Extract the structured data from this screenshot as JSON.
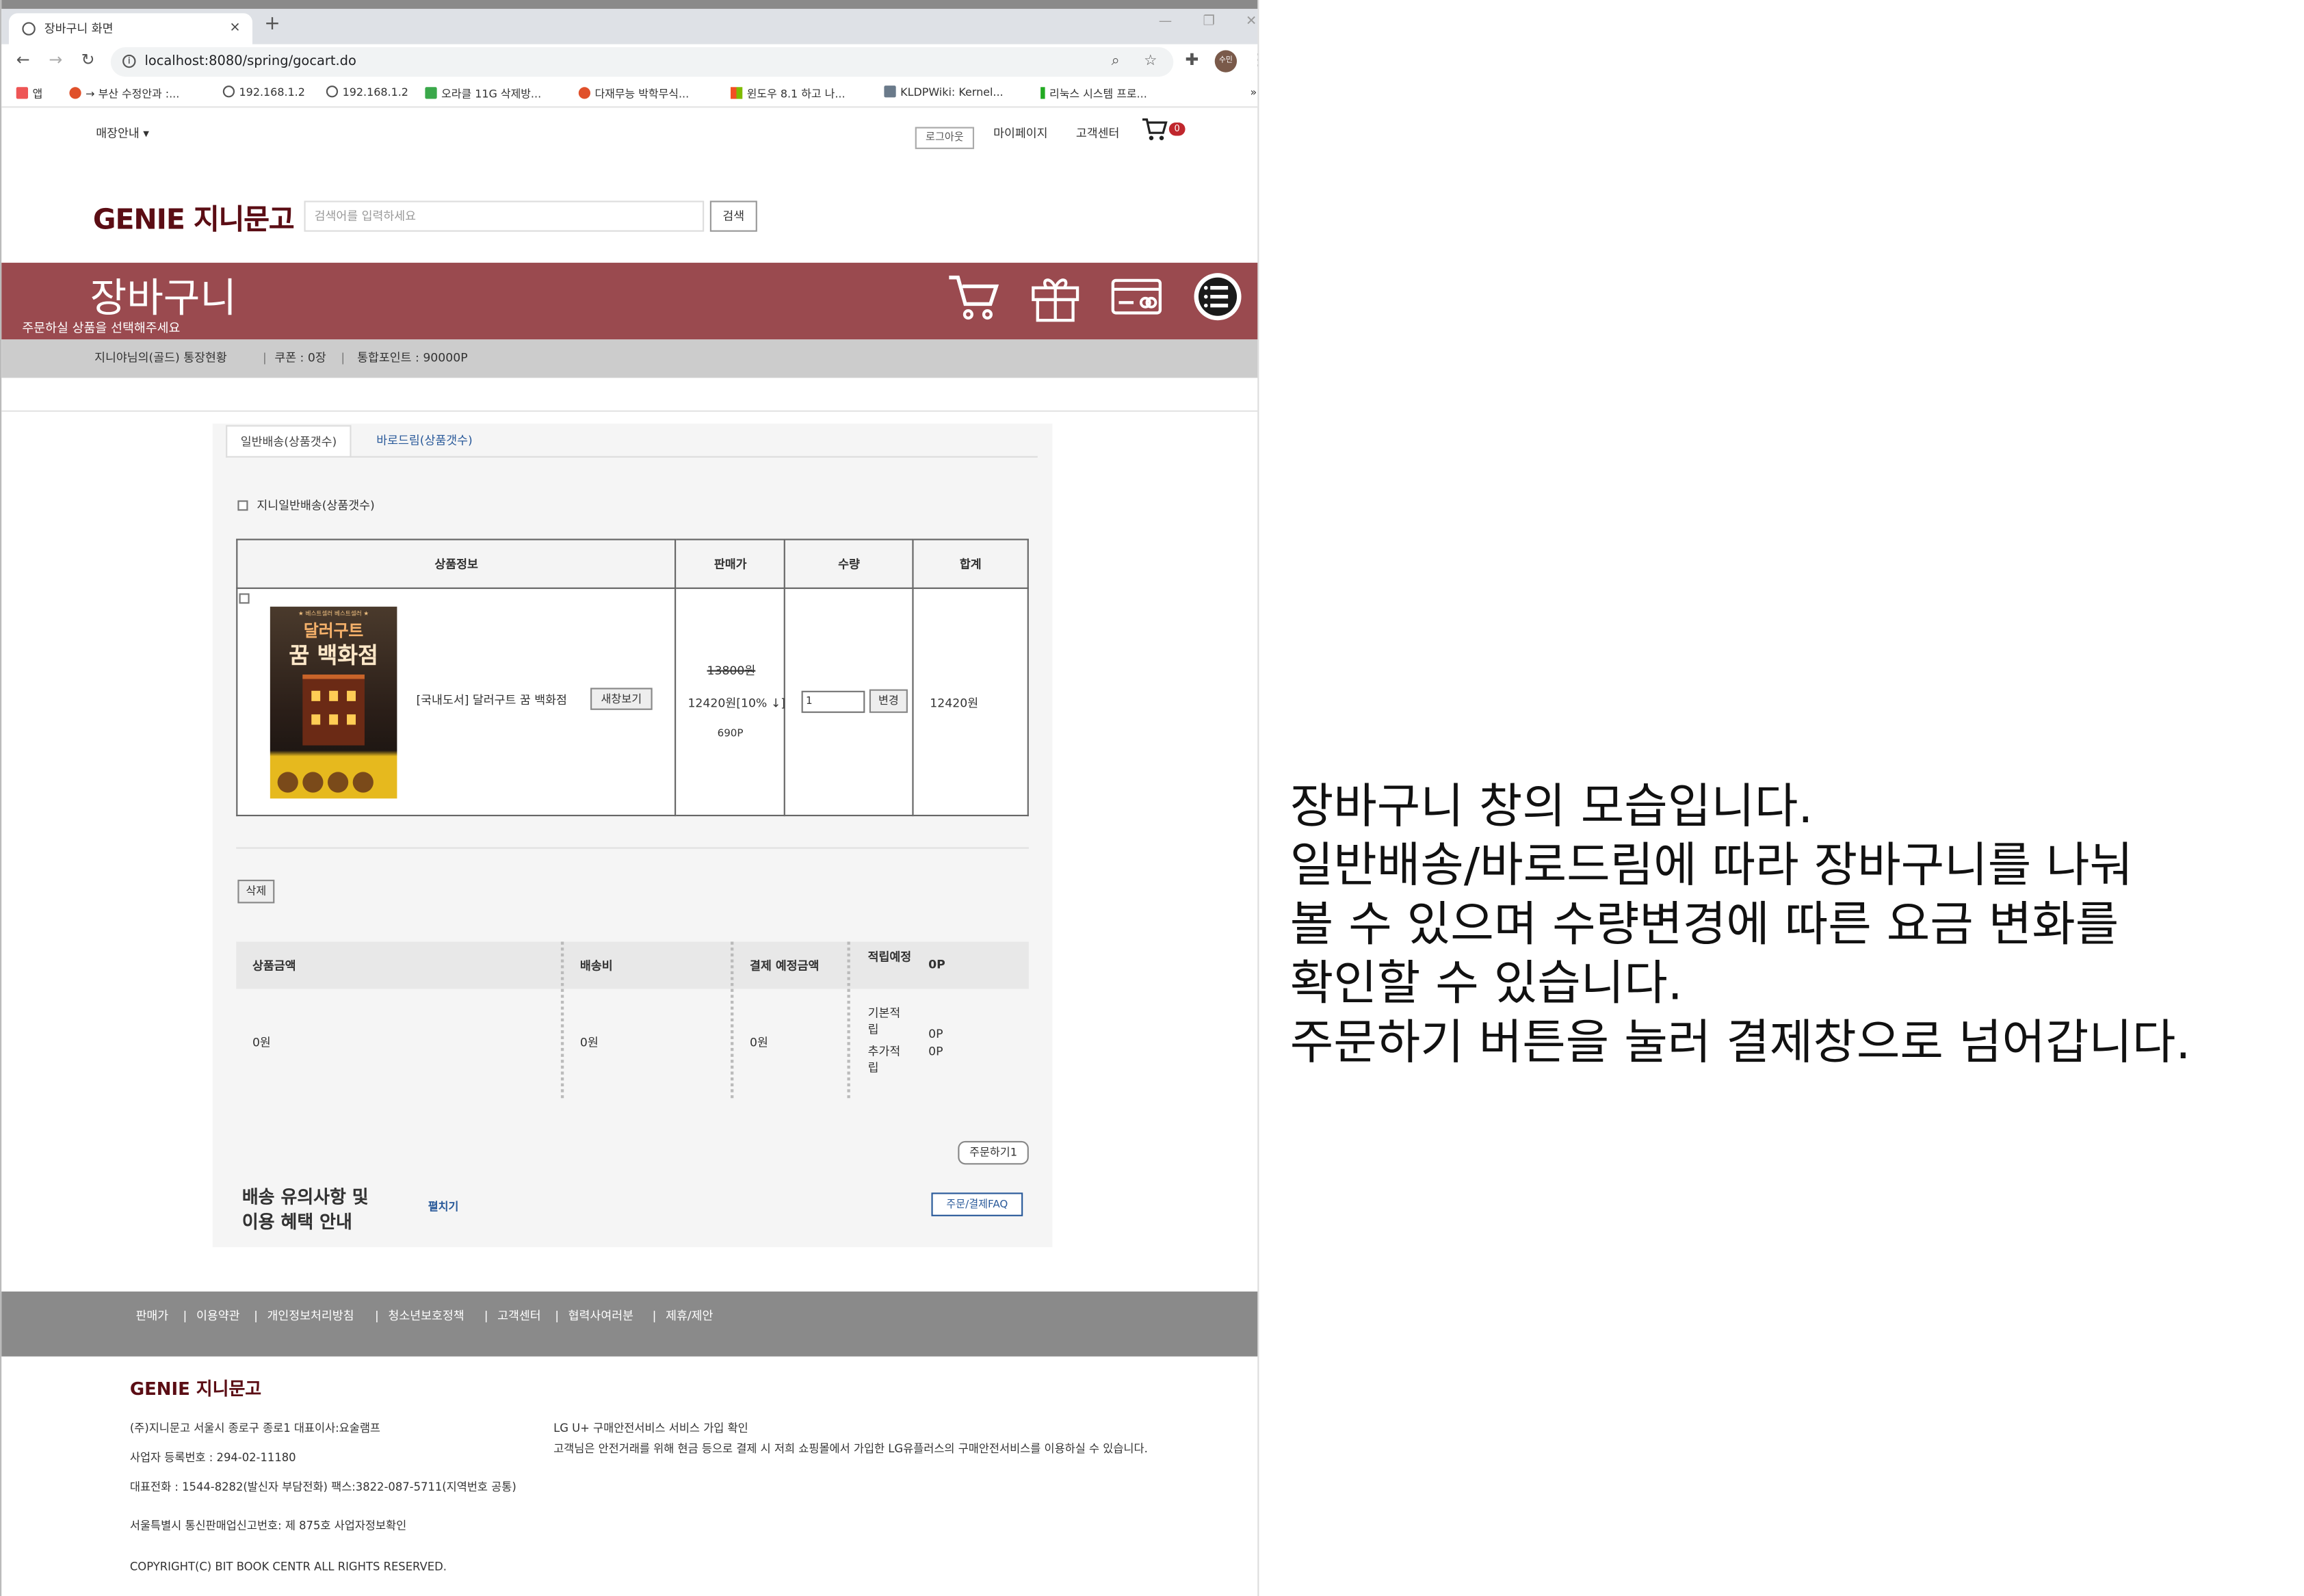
{
  "browser": {
    "tab_title": "장바구니 화면",
    "tab_close": "×",
    "new_tab": "+",
    "win_min": "—",
    "win_max": "❐",
    "win_close": "✕",
    "url": "localhost:8080/spring/gocart.do",
    "profile": "수민",
    "bookmarks": [
      "앱",
      "→ 부산 수정안과 :...",
      "192.168.1.2",
      "192.168.1.2",
      "오라클 11G 삭제방...",
      "다재무능 박학무식...",
      "윈도우 8.1 하고 나...",
      "KLDPWiki: Kernel...",
      "리눅스 시스템 프로..."
    ],
    "bookmark_more": "»"
  },
  "header": {
    "store_menu": "매장안내 ▾",
    "logout": "로그아웃",
    "mypage": "마이페이지",
    "support": "고객센터",
    "cart_count": "0",
    "logo": "GENIE 지니문고",
    "search_placeholder": "검색어를 입력하세요",
    "search_button": "검색"
  },
  "banner": {
    "title": "장바구니",
    "subtitle": "주문하실 상품을 선택해주세요",
    "status": "지니야님의(골드) 통장현황",
    "coupon": "쿠폰 : 0장",
    "points": "통합포인트 : 90000P"
  },
  "cart": {
    "tabs": [
      "일반배송(상품갯수)",
      "바로드림(상품갯수)"
    ],
    "select_all_label": "지니일반배송(상품갯수)",
    "columns": [
      "상품정보",
      "판매가",
      "수량",
      "합계"
    ],
    "items": [
      {
        "cover_series": "★ 베스트셀러 베스트셀러 ★",
        "cover_title1": "달러구트",
        "cover_title2": "꿈 백화점",
        "name": "[국내도서] 달러구트 꿈 백화점",
        "new_window": "새창보기",
        "list_price": "13800원",
        "sale_price": "12420원[10% ↓]",
        "points": "690P",
        "quantity": "1",
        "change_button": "변경",
        "total": "12420원"
      }
    ],
    "delete_button": "삭제"
  },
  "summary": {
    "headers": [
      "상품금액",
      "배송비",
      "결제 예정금액",
      "적립예정",
      "0P"
    ],
    "product_amount": "0원",
    "shipping": "0원",
    "expected_payment": "0원",
    "basic_label": "기본적립",
    "basic_points": "0P",
    "extra_label": "추가적립",
    "extra_points": "0P",
    "order_button": "주문하기1"
  },
  "notice": {
    "title_line1": "배송 유의사항 및",
    "title_line2": "이용 혜택 안내",
    "expand": "펼치기",
    "faq_button": "주문/결제FAQ"
  },
  "footer": {
    "links": [
      "판매가",
      "이용약관",
      "개인정보처리방침",
      "청소년보호정책",
      "고객센터",
      "협력사여러분",
      "제휴/제안"
    ],
    "logo": "GENIE 지니문고",
    "company": "(주)지니문고 서울시 종로구 종로1 대표이사:요술램프",
    "biz_no": "사업자 등록번호 : 294-02-11180",
    "phone": "대표전화 : 1544-8282(발신자 부담전화) 팩스:3822-087-5711(지역번호 공통)",
    "mail_order": "서울특별시 통신판매업신고번호: 제 875호 사업자정보확인",
    "copyright": "COPYRIGHT(C) BIT BOOK CENTR ALL RIGHTS RESERVED.",
    "lg_title": "LG U+ 구매안전서비스 서비스 가입 확인",
    "lg_desc": "고객님은 안전거래를 위해 현금 등으로 결제 시 저희 쇼핑몰에서 가입한 LG유플러스의 구매안전서비스를 이용하실 수 있습니다."
  },
  "annotation": {
    "text": "장바구니 창의 모습입니다.\n일반배송/바로드림에 따라 장바구니를 나눠\n볼 수 있으며 수량변경에 따른 요금 변화를\n확인할 수 있습니다.\n주문하기 버튼을 눌러 결제창으로 넘어갑니다."
  },
  "colors": {
    "brand": "#5b0d14",
    "banner": "#9a4a4f",
    "link_blue": "#2a5a9a",
    "footer_bar": "#8a8a8a"
  }
}
